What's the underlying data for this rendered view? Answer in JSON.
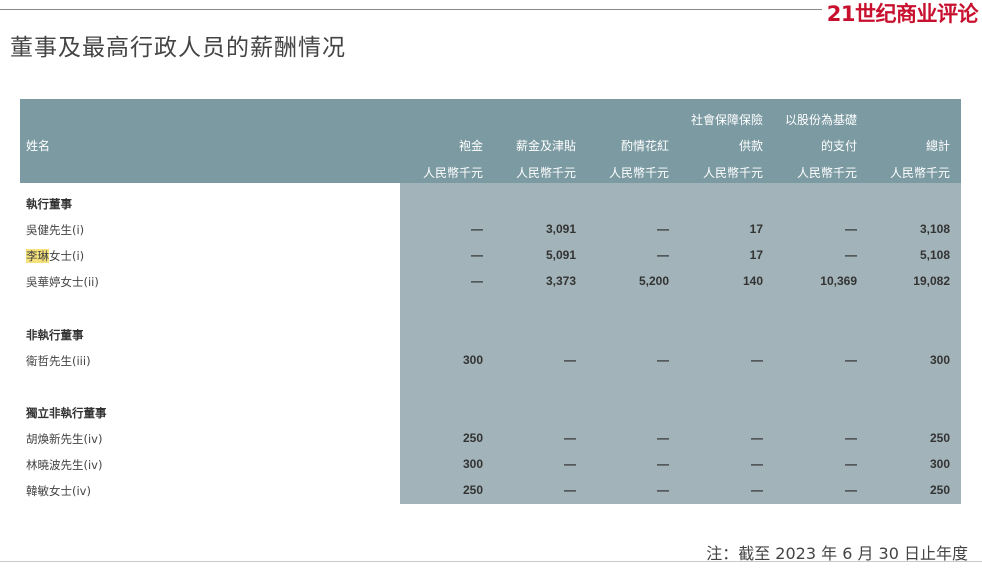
{
  "brand": "21世纪商业评论",
  "title": "董事及最高行政人员的薪酬情况",
  "table": {
    "headers": {
      "name": "姓名",
      "fee": "袍金",
      "salary": "薪金及津貼",
      "bonus": "酌情花紅",
      "social_1": "社會保障保險",
      "social_2": "供款",
      "share_1": "以股份為基礎",
      "share_2": "的支付",
      "total": "總計",
      "unit": "人民幣千元"
    },
    "sections": [
      {
        "title": "執行董事",
        "rows": [
          {
            "name": "吳健先生",
            "note": "(i)",
            "highlight": "",
            "fee": "—",
            "salary": "3,091",
            "bonus": "—",
            "social": "17",
            "share": "—",
            "total": "3,108"
          },
          {
            "name": "李琳",
            "note": "(i)",
            "highlight": "李琳",
            "suffix": "女士",
            "fee": "—",
            "salary": "5,091",
            "bonus": "—",
            "social": "17",
            "share": "—",
            "total": "5,108"
          },
          {
            "name": "吳華婷女士",
            "note": "(ii)",
            "highlight": "",
            "fee": "—",
            "salary": "3,373",
            "bonus": "5,200",
            "social": "140",
            "share": "10,369",
            "total": "19,082"
          }
        ]
      },
      {
        "title": "非執行董事",
        "rows": [
          {
            "name": "衛哲先生",
            "note": "(iii)",
            "highlight": "",
            "fee": "300",
            "salary": "—",
            "bonus": "—",
            "social": "—",
            "share": "—",
            "total": "300"
          }
        ]
      },
      {
        "title": "獨立非執行董事",
        "rows": [
          {
            "name": "胡煥新先生",
            "note": "(iv)",
            "highlight": "",
            "fee": "250",
            "salary": "—",
            "bonus": "—",
            "social": "—",
            "share": "—",
            "total": "250"
          },
          {
            "name": "林曉波先生",
            "note": "(iv)",
            "highlight": "",
            "fee": "300",
            "salary": "—",
            "bonus": "—",
            "social": "—",
            "share": "—",
            "total": "300"
          },
          {
            "name": "韓敏女士",
            "note": "(iv)",
            "highlight": "",
            "fee": "250",
            "salary": "—",
            "bonus": "—",
            "social": "—",
            "share": "—",
            "total": "250"
          }
        ]
      }
    ]
  },
  "footnote": "注：截至 2023 年 6 月 30 日止年度",
  "colors": {
    "header_bg": "#7b9aa2",
    "body_bg": "#a2b4b9",
    "brand": "#c8102e",
    "highlight": "#f6e27a"
  }
}
